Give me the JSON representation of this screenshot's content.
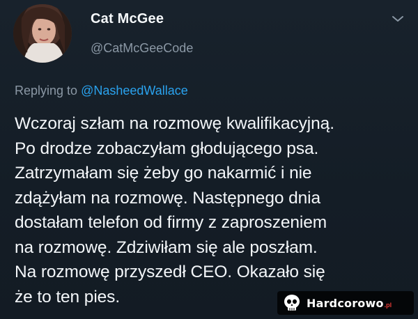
{
  "author": {
    "display_name": "Cat McGee",
    "handle": "@CatMcGeeCode"
  },
  "reply": {
    "prefix": "Replying to ",
    "handle": "@NasheedWallace"
  },
  "tweet": {
    "text": "Wczoraj szłam na rozmowę kwalifikacyjną.\nPo drodze zobaczyłam głodującego psa.\nZatrzymałam się żeby go nakarmić i nie\nzdążyłam na rozmowę. Następnego dnia\ndostałam telefon od firmy z zaproszeniem\nna rozmowę. Zdziwiłam się ale poszłam.\nNa rozmowę przyszedł CEO. Okazało się\nże to ten pies."
  },
  "watermark": {
    "name": "Hardcorowo",
    "suffix": ".pl"
  },
  "icons": {
    "menu": "chevron-down-icon",
    "watermark_logo": "skull-icon"
  },
  "colors": {
    "background": "#141d26",
    "link": "#2aa3ef",
    "secondary_text": "#8b98a5"
  }
}
